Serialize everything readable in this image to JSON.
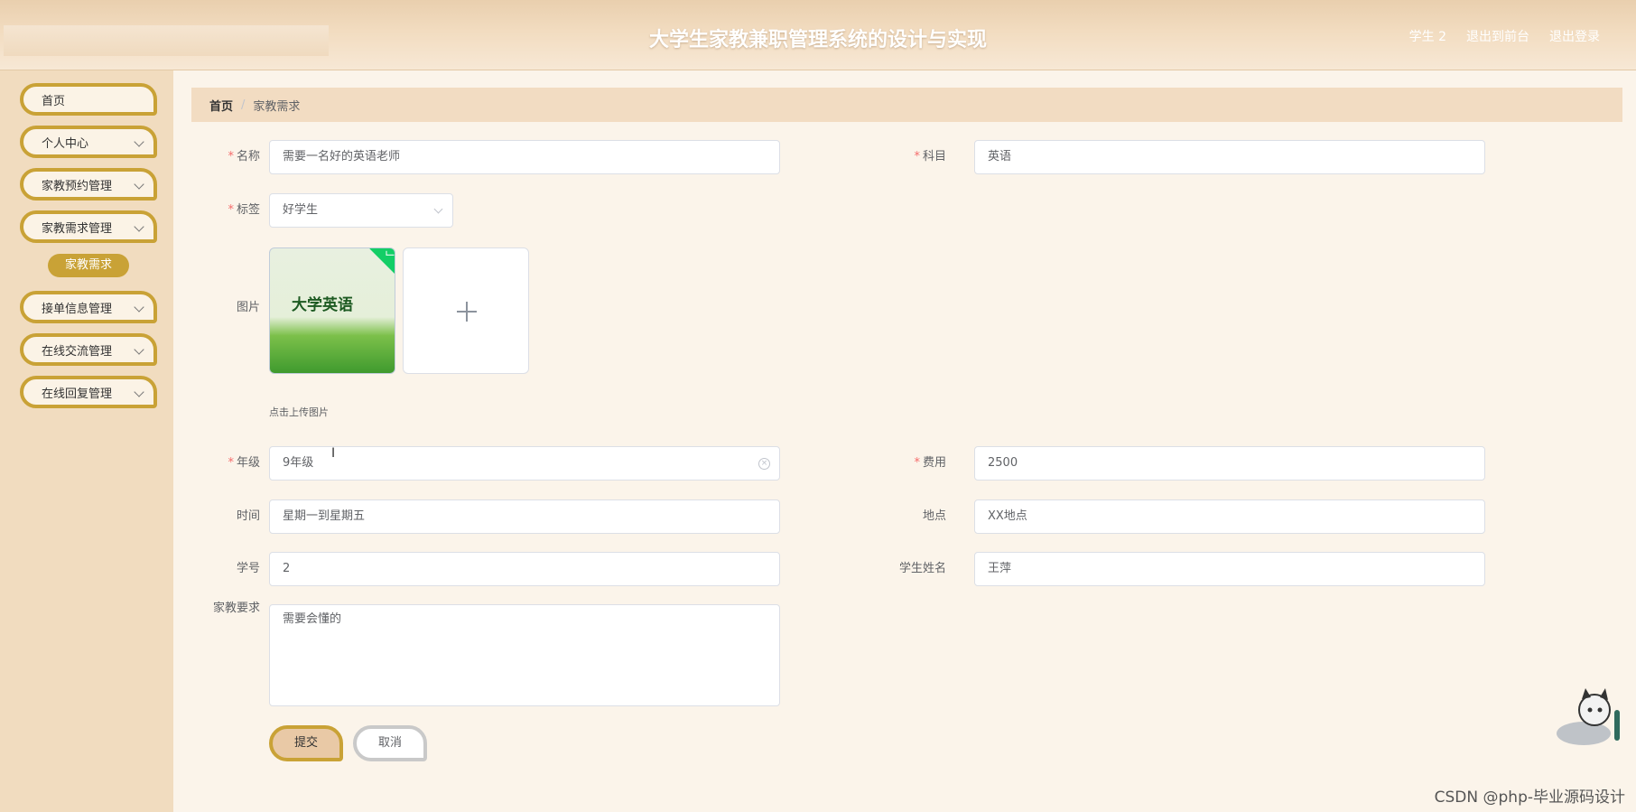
{
  "header": {
    "title": "大学生家教兼职管理系统的设计与实现",
    "nav": [
      "学生 2",
      "退出到前台",
      "退出登录"
    ]
  },
  "sidebar": {
    "items": [
      {
        "label": "首页",
        "has_arrow": false
      },
      {
        "label": "个人中心",
        "has_arrow": true
      },
      {
        "label": "家教预约管理",
        "has_arrow": true
      },
      {
        "label": "家教需求管理",
        "has_arrow": true
      },
      {
        "label": "接单信息管理",
        "has_arrow": true
      },
      {
        "label": "在线交流管理",
        "has_arrow": true
      },
      {
        "label": "在线回复管理",
        "has_arrow": true
      }
    ],
    "active_sub": "家教需求"
  },
  "breadcrumb": {
    "home": "首页",
    "sep": "/",
    "current": "家教需求"
  },
  "form": {
    "name": {
      "label": "名称",
      "value": "需要一名好的英语老师"
    },
    "subject": {
      "label": "科目",
      "value": "英语"
    },
    "tag": {
      "label": "标签",
      "value": "好学生"
    },
    "image": {
      "label": "图片",
      "hint": "点击上传图片",
      "thumb_text": "大学英语"
    },
    "grade": {
      "label": "年级",
      "value": "9年级"
    },
    "fee": {
      "label": "费用",
      "value": "2500"
    },
    "time": {
      "label": "时间",
      "value": "星期一到星期五"
    },
    "place": {
      "label": "地点",
      "value": "XX地点"
    },
    "student_no": {
      "label": "学号",
      "value": "2"
    },
    "student_name": {
      "label": "学生姓名",
      "value": "王萍"
    },
    "requirement": {
      "label": "家教要求",
      "value": "需要会懂的"
    },
    "required_mark": "*"
  },
  "buttons": {
    "submit": "提交",
    "cancel": "取消"
  },
  "watermark": "CSDN @php-毕业源码设计",
  "colors": {
    "accent": "#c9a236",
    "header_bg": "#efd6b7",
    "sidebar_bg": "#f1dcbf",
    "required": "#f56c6c"
  }
}
